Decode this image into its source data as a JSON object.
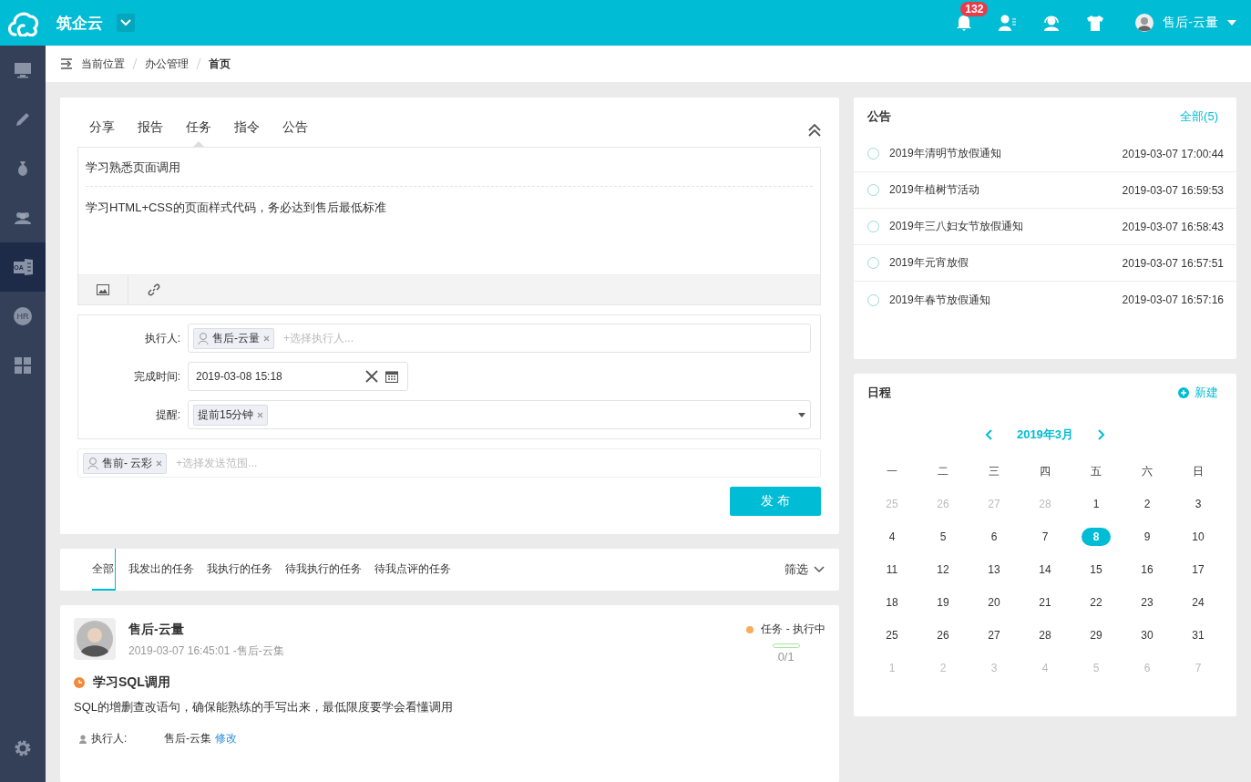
{
  "topbar": {
    "app_name": "筑企云",
    "notification_count": "132",
    "user_name": "售后-云量"
  },
  "sidebar": {
    "items": [
      {
        "kind": "monitor",
        "selected": false
      },
      {
        "kind": "pencil",
        "selected": false
      },
      {
        "kind": "moneybag",
        "selected": false
      },
      {
        "kind": "people",
        "selected": false
      },
      {
        "kind": "oa",
        "icon_text": "OA",
        "selected": true
      },
      {
        "kind": "hr",
        "icon_text": "HR",
        "selected": false
      },
      {
        "kind": "grid",
        "selected": false
      }
    ]
  },
  "breadcrumb": [
    "当前位置",
    "办公管理",
    "首页"
  ],
  "composer": {
    "tabs": [
      {
        "label": "分享",
        "selected": false
      },
      {
        "label": "报告",
        "selected": false
      },
      {
        "label": "任务",
        "selected": true
      },
      {
        "label": "指令",
        "selected": false
      },
      {
        "label": "公告",
        "selected": false
      }
    ],
    "title": "学习熟悉页面调用",
    "body": "学习HTML+CSS的页面样式代码，务必达到售后最低标准",
    "assignee_label": "执行人:",
    "assignees": [
      "售后-云量"
    ],
    "assignee_placeholder": "+选择执行人...",
    "due_label": "完成时间:",
    "due_value": "2019-03-08 15:18",
    "reminder_label": "提醒:",
    "reminders": [
      "提前15分钟"
    ],
    "scope_tags": [
      "售前- 云彩"
    ],
    "scope_placeholder": "+选择发送范围...",
    "submit": "发 布"
  },
  "task_tabs": {
    "tabs": [
      {
        "label": "全部",
        "selected": true
      },
      {
        "label": "我发出的任务",
        "selected": false
      },
      {
        "label": "我执行的任务",
        "selected": false
      },
      {
        "label": "待我执行的任务",
        "selected": false
      },
      {
        "label": "待我点评的任务",
        "selected": false
      }
    ],
    "filter": "筛选"
  },
  "task": {
    "author": "售后-云量",
    "meta": "2019-03-07 16:45:01 -售后-云集",
    "status": "任务 - 执行中",
    "progress": "0/1",
    "level": 0,
    "title": "学习SQL调用",
    "description": "SQL的增删查改语句，确保能熟练的手写出来，最低限度要学会看懂调用",
    "fields": [
      {
        "label": "执行人:",
        "value": "售后-云集",
        "action": "修改"
      }
    ]
  },
  "announcements": {
    "title": "公告",
    "all_link": "全部(5)",
    "items": [
      {
        "title": "2019年清明节放假通知",
        "time": "2019-03-07 17:00:44"
      },
      {
        "title": "2019年植树节活动",
        "time": "2019-03-07 16:59:53"
      },
      {
        "title": "2019年三八妇女节放假通知",
        "time": "2019-03-07 16:58:43"
      },
      {
        "title": "2019年元宵放假",
        "time": "2019-03-07 16:57:51"
      },
      {
        "title": "2019年春节放假通知",
        "time": "2019-03-07 16:57:16"
      }
    ]
  },
  "schedule": {
    "title": "日程",
    "new_button": "新建",
    "month": "2019年3月",
    "weekdays": [
      "一",
      "二",
      "三",
      "四",
      "五",
      "六",
      "日"
    ],
    "days": [
      {
        "label": "25",
        "muted": true,
        "selected": false
      },
      {
        "label": "26",
        "muted": true,
        "selected": false
      },
      {
        "label": "27",
        "muted": true,
        "selected": false
      },
      {
        "label": "28",
        "muted": true,
        "selected": false
      },
      {
        "label": "1",
        "muted": false,
        "selected": false
      },
      {
        "label": "2",
        "muted": false,
        "selected": false
      },
      {
        "label": "3",
        "muted": false,
        "selected": false
      },
      {
        "label": "4",
        "muted": false,
        "selected": false
      },
      {
        "label": "5",
        "muted": false,
        "selected": false
      },
      {
        "label": "6",
        "muted": false,
        "selected": false
      },
      {
        "label": "7",
        "muted": false,
        "selected": false
      },
      {
        "label": "8",
        "muted": false,
        "selected": true
      },
      {
        "label": "9",
        "muted": false,
        "selected": false
      },
      {
        "label": "10",
        "muted": false,
        "selected": false
      },
      {
        "label": "11",
        "muted": false,
        "selected": false
      },
      {
        "label": "12",
        "muted": false,
        "selected": false
      },
      {
        "label": "13",
        "muted": false,
        "selected": false
      },
      {
        "label": "14",
        "muted": false,
        "selected": false
      },
      {
        "label": "15",
        "muted": false,
        "selected": false
      },
      {
        "label": "16",
        "muted": false,
        "selected": false
      },
      {
        "label": "17",
        "muted": false,
        "selected": false
      },
      {
        "label": "18",
        "muted": false,
        "selected": false
      },
      {
        "label": "19",
        "muted": false,
        "selected": false
      },
      {
        "label": "20",
        "muted": false,
        "selected": false
      },
      {
        "label": "21",
        "muted": false,
        "selected": false
      },
      {
        "label": "22",
        "muted": false,
        "selected": false
      },
      {
        "label": "23",
        "muted": false,
        "selected": false
      },
      {
        "label": "24",
        "muted": false,
        "selected": false
      },
      {
        "label": "25",
        "muted": false,
        "selected": false
      },
      {
        "label": "26",
        "muted": false,
        "selected": false
      },
      {
        "label": "27",
        "muted": false,
        "selected": false
      },
      {
        "label": "28",
        "muted": false,
        "selected": false
      },
      {
        "label": "29",
        "muted": false,
        "selected": false
      },
      {
        "label": "30",
        "muted": false,
        "selected": false
      },
      {
        "label": "31",
        "muted": false,
        "selected": false
      },
      {
        "label": "1",
        "muted": true,
        "selected": false
      },
      {
        "label": "2",
        "muted": true,
        "selected": false
      },
      {
        "label": "3",
        "muted": true,
        "selected": false
      },
      {
        "label": "4",
        "muted": true,
        "selected": false
      },
      {
        "label": "5",
        "muted": true,
        "selected": false
      },
      {
        "label": "6",
        "muted": true,
        "selected": false
      },
      {
        "label": "7",
        "muted": true,
        "selected": false
      }
    ]
  }
}
